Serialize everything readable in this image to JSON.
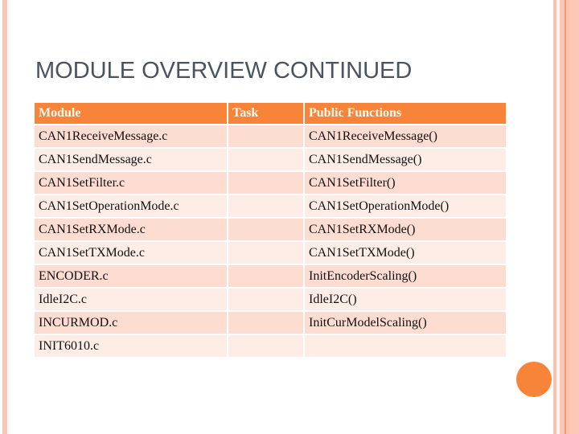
{
  "slide": {
    "title": "MODULE OVERVIEW CONTINUED",
    "accent_color": "#f8843a",
    "row_colors": [
      "#fddcd2",
      "#feece6"
    ]
  },
  "table": {
    "headers": [
      "Module",
      "Task",
      "Public Functions"
    ],
    "rows": [
      {
        "module": "CAN1ReceiveMessage.c",
        "task": "",
        "functions": "CAN1ReceiveMessage()"
      },
      {
        "module": "CAN1SendMessage.c",
        "task": "",
        "functions": "CAN1SendMessage()"
      },
      {
        "module": "CAN1SetFilter.c",
        "task": "",
        "functions": "CAN1SetFilter()"
      },
      {
        "module": "CAN1SetOperationMode.c",
        "task": "",
        "functions": "CAN1SetOperationMode()"
      },
      {
        "module": "CAN1SetRXMode.c",
        "task": "",
        "functions": "CAN1SetRXMode()"
      },
      {
        "module": "CAN1SetTXMode.c",
        "task": "",
        "functions": "CAN1SetTXMode()"
      },
      {
        "module": "ENCODER.c",
        "task": "",
        "functions": "InitEncoderScaling()"
      },
      {
        "module": "IdleI2C.c",
        "task": "",
        "functions": "IdleI2C()"
      },
      {
        "module": "INCURMOD.c",
        "task": "",
        "functions": "InitCurModelScaling()"
      },
      {
        "module": "INIT6010.c",
        "task": "",
        "functions": ""
      }
    ]
  }
}
